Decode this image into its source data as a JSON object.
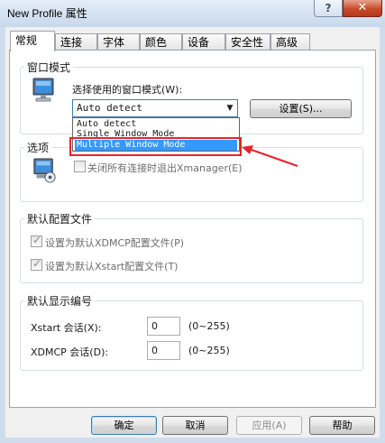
{
  "window": {
    "title": "New Profile 属性",
    "help_glyph": "?",
    "close_glyph": "✕"
  },
  "tabs": [
    {
      "label": "常规",
      "active": true
    },
    {
      "label": "连接"
    },
    {
      "label": "字体"
    },
    {
      "label": "颜色"
    },
    {
      "label": "设备"
    },
    {
      "label": "安全性"
    },
    {
      "label": "高级"
    }
  ],
  "window_mode": {
    "group_title": "窗口模式",
    "select_label": "选择使用的窗口模式(W):",
    "current_value": "Auto detect",
    "options": [
      "Auto detect",
      "Single Window Mode",
      "Multiple Window Mode"
    ],
    "highlighted_option": "Multiple Window Mode",
    "settings_button": "设置(S)..."
  },
  "options": {
    "group_title": "选项",
    "close_on_exit_label": "关闭所有连接时退出Xmanager(E)",
    "close_on_exit_checked": false
  },
  "default_config": {
    "group_title": "默认配置文件",
    "xdmcp_label": "设置为默认XDMCP配置文件(P)",
    "xdmcp_checked": true,
    "xstart_label": "设置为默认Xstart配置文件(T)",
    "xstart_checked": true
  },
  "default_display": {
    "group_title": "默认显示编号",
    "xstart_label": "Xstart 会话(X):",
    "xstart_value": "0",
    "xstart_range": "(0~255)",
    "xdmcp_label": "XDMCP 会话(D):",
    "xdmcp_value": "0",
    "xdmcp_range": "(0~255)"
  },
  "footer": {
    "ok": "确定",
    "cancel": "取消",
    "apply": "应用(A)",
    "help": "帮助"
  },
  "annotation_color": "#e8232a"
}
